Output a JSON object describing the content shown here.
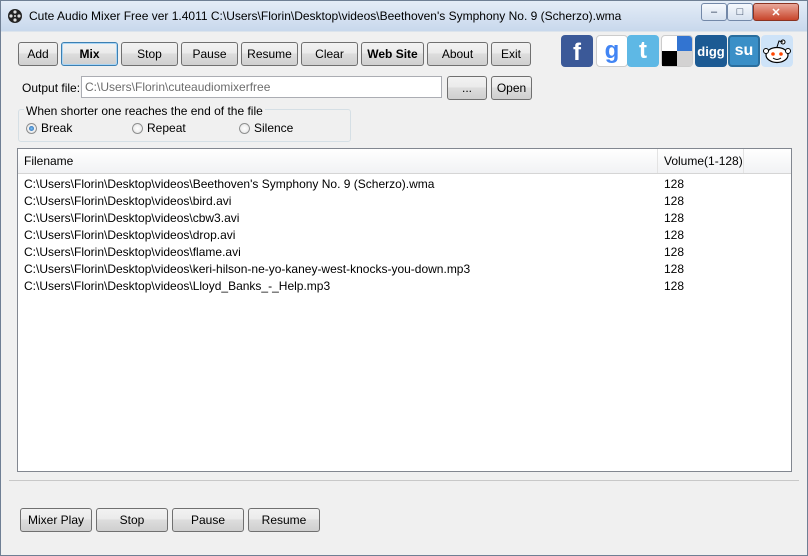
{
  "window": {
    "title": "Cute Audio Mixer Free ver 1.4011  C:\\Users\\Florin\\Desktop\\videos\\Beethoven's Symphony No. 9 (Scherzo).wma",
    "controls": {
      "minimize": "–",
      "maximize": "□",
      "close": "✕"
    }
  },
  "toolbar": {
    "add": "Add",
    "mix": "Mix",
    "stop": "Stop",
    "pause": "Pause",
    "resume": "Resume",
    "clear": "Clear",
    "website": "Web Site",
    "about": "About",
    "exit": "Exit"
  },
  "social": {
    "facebook": "f",
    "google": "g",
    "twitter": "t",
    "delicious": "",
    "digg": "digg",
    "stumbleupon": "su",
    "reddit": ""
  },
  "output": {
    "label": "Output file:",
    "value": "C:\\Users\\Florin\\cuteaudiomixerfree",
    "browse": "...",
    "open": "Open"
  },
  "shorter": {
    "legend": "When shorter one reaches the end of the file",
    "options": [
      "Break",
      "Repeat",
      "Silence"
    ],
    "selected": "Break"
  },
  "list": {
    "headers": [
      "Filename",
      "Volume(1-128)"
    ],
    "rows": [
      {
        "filename": "C:\\Users\\Florin\\Desktop\\videos\\Beethoven's Symphony No. 9 (Scherzo).wma",
        "volume": "128"
      },
      {
        "filename": "C:\\Users\\Florin\\Desktop\\videos\\bird.avi",
        "volume": "128"
      },
      {
        "filename": "C:\\Users\\Florin\\Desktop\\videos\\cbw3.avi",
        "volume": "128"
      },
      {
        "filename": "C:\\Users\\Florin\\Desktop\\videos\\drop.avi",
        "volume": "128"
      },
      {
        "filename": "C:\\Users\\Florin\\Desktop\\videos\\flame.avi",
        "volume": "128"
      },
      {
        "filename": "C:\\Users\\Florin\\Desktop\\videos\\keri-hilson-ne-yo-kaney-west-knocks-you-down.mp3",
        "volume": "128"
      },
      {
        "filename": "C:\\Users\\Florin\\Desktop\\videos\\Lloyd_Banks_-_Help.mp3",
        "volume": "128"
      }
    ]
  },
  "player": {
    "mixer_play": "Mixer Play",
    "stop": "Stop",
    "pause": "Pause",
    "resume": "Resume"
  },
  "colors": {
    "facebook": "#3b5998",
    "twitter": "#5eb8e5",
    "digg": "#1c5a93",
    "stumbleupon": "#3a8fc7",
    "reddit": "#cee3f8",
    "radio_accent": "#1b5aa5"
  }
}
